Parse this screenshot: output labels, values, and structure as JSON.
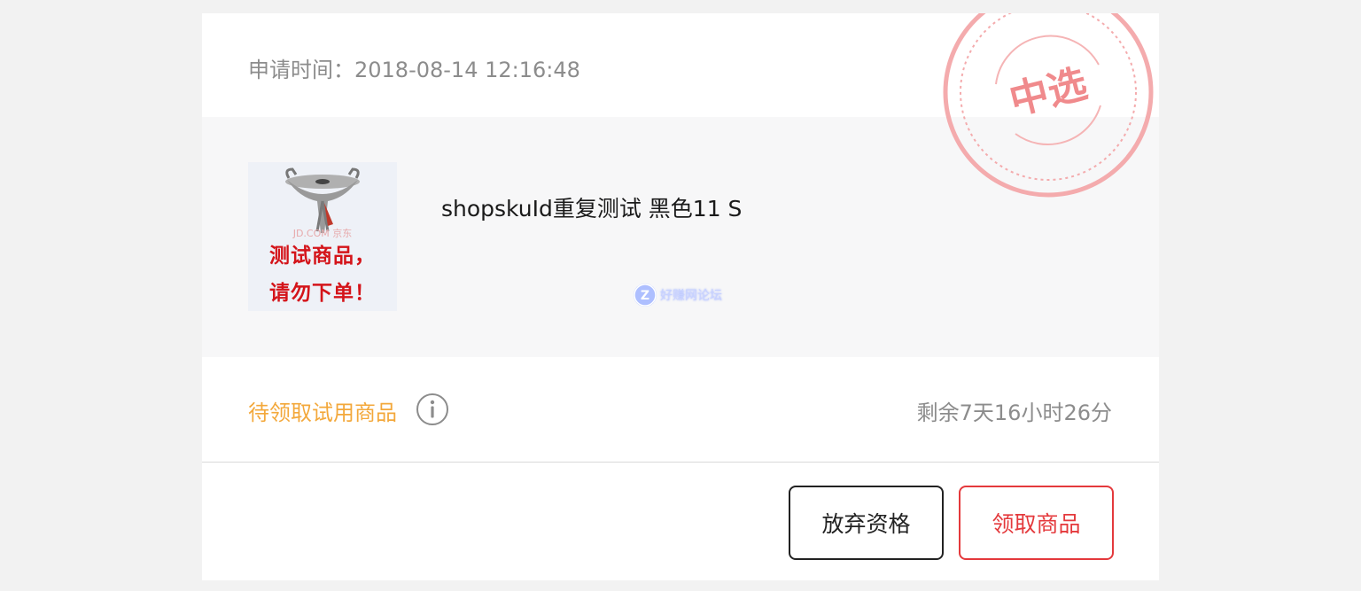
{
  "header": {
    "apply_time": "申请时间：2018-08-14 12:16:48"
  },
  "product": {
    "thumb_line1": "测试商品，",
    "thumb_line2": "请勿下单！",
    "thumb_brand": "JD.COM 京东",
    "name": "shopskuId重复测试 黑色11 S"
  },
  "watermark": {
    "text": "好赚网论坛",
    "logo_letter": "Z"
  },
  "status": {
    "label": "待领取试用商品",
    "info_icon": "info-icon",
    "countdown": "剩余7天16小时26分"
  },
  "actions": {
    "abandon_label": "放弃资格",
    "claim_label": "领取商品"
  },
  "stamp": {
    "text": "中选"
  },
  "colors": {
    "background": "#f2f2f2",
    "status_orange": "#f3a83b",
    "claim_red": "#e4393c",
    "stamp_pink": "#f08a8c",
    "gray_text": "#8c8c8c"
  }
}
